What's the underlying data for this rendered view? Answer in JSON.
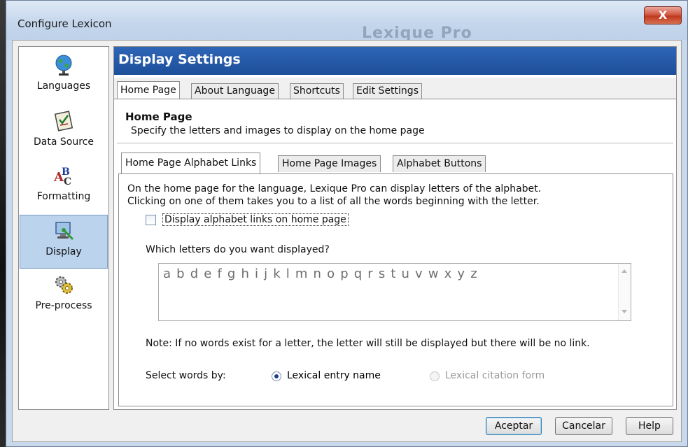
{
  "window": {
    "title": "Configure Lexicon",
    "background_title": "Lexique Pro",
    "close_label": "X"
  },
  "sidebar": {
    "items": [
      {
        "label": "Languages",
        "icon": "globe-icon"
      },
      {
        "label": "Data Source",
        "icon": "checklist-icon"
      },
      {
        "label": "Formatting",
        "icon": "abc-icon"
      },
      {
        "label": "Display",
        "icon": "display-icon",
        "selected": true
      },
      {
        "label": "Pre-process",
        "icon": "gears-icon"
      }
    ]
  },
  "panel": {
    "title": "Display Settings",
    "tabs": [
      {
        "label": "Home Page",
        "active": true
      },
      {
        "label": "About Language"
      },
      {
        "label": "Shortcuts"
      },
      {
        "label": "Edit Settings"
      }
    ],
    "section_title": "Home Page",
    "section_desc": "Specify the letters and images to display on the home page",
    "subtabs": [
      {
        "label": "Home Page Alphabet Links",
        "active": true
      },
      {
        "label": "Home Page Images"
      },
      {
        "label": "Alphabet Buttons"
      }
    ],
    "info_line1": "On the home page for the language, Lexique Pro can display letters of the alphabet.",
    "info_line2": "Clicking on one of them takes you to a list of all the words beginning with the letter.",
    "checkbox_label": "Display alphabet links on home page",
    "checkbox_checked": false,
    "letters_question": "Which letters do you want displayed?",
    "letters_value": "a b d e f g h i j k l m n o p q r s t u v w x y z",
    "note": "Note: If no words exist for a letter, the letter will still be displayed but there will be no link.",
    "select_label": "Select words by:",
    "radio_options": [
      {
        "label": "Lexical entry name",
        "selected": true,
        "enabled": true
      },
      {
        "label": "Lexical citation form",
        "selected": false,
        "enabled": false
      }
    ]
  },
  "buttons": {
    "ok": "Aceptar",
    "cancel": "Cancelar",
    "help": "Help"
  },
  "colors": {
    "header_blue": "#1d4f9a",
    "selection": "#bcd3ee",
    "close_red": "#c0391f"
  }
}
